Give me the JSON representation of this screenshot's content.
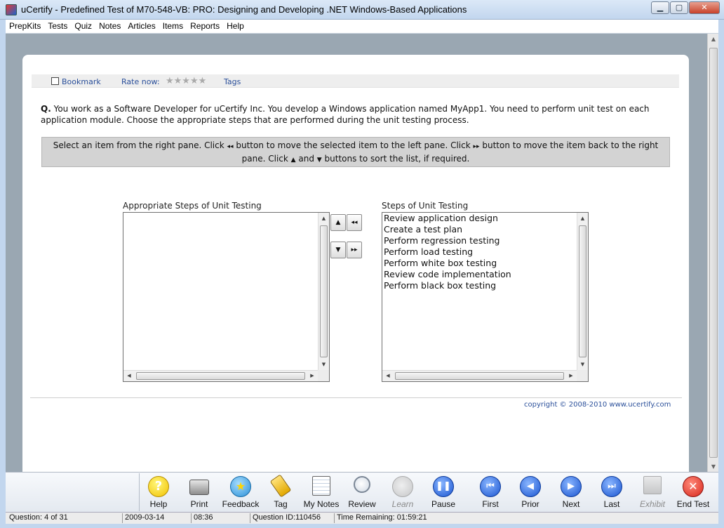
{
  "window": {
    "title": "uCertify - Predefined Test of  M70-548-VB: PRO: Designing and Developing .NET Windows-Based Applications",
    "minimize": "▁",
    "maximize": "▢",
    "close": "✕"
  },
  "menu": [
    "PrepKits",
    "Tests",
    "Quiz",
    "Notes",
    "Articles",
    "Items",
    "Reports",
    "Help"
  ],
  "toolbar": {
    "bookmark": "Bookmark",
    "rate_now": "Rate now:",
    "stars": "★★★★★",
    "rating": 0,
    "tags": "Tags"
  },
  "question": {
    "prefix": "Q.",
    "text": " You work as a Software Developer for uCertify Inc. You develop a Windows application named MyApp1. You need to perform unit test on each application module. Choose the appropriate steps that are performed during the unit testing process."
  },
  "instruction": {
    "part1": "Select an item from the right pane. Click ",
    "glyph_left": "◂◂",
    "part2": " button to move the selected item to the left pane. Click ",
    "glyph_right": "▸▸",
    "part3": " button to move the item back to the right pane. Click ",
    "glyph_up": "▲",
    "part4": " and ",
    "glyph_down": "▼",
    "part5": " buttons to sort the list, if required."
  },
  "left_list": {
    "label": "Appropriate Steps of Unit Testing",
    "items": []
  },
  "right_list": {
    "label": "Steps of Unit Testing",
    "items": [
      "Review application design",
      "Create a test plan",
      "Perform regression testing",
      "Perform load testing",
      "Perform white box testing",
      "Review code implementation",
      "Perform black box testing"
    ]
  },
  "buttons": {
    "move_up": "▲",
    "move_left": "◂◂",
    "move_down": "▼",
    "move_right": "▸▸"
  },
  "copyright": "copyright © 2008-2010 www.ucertify.com",
  "bottom_toolbar": [
    {
      "label": "Help",
      "glyph": "?"
    },
    {
      "label": "Print",
      "glyph": ""
    },
    {
      "label": "Feedback",
      "glyph": "★"
    },
    {
      "label": "Tag",
      "glyph": ""
    },
    {
      "label": "My Notes",
      "glyph": ""
    },
    {
      "label": "Review",
      "glyph": ""
    },
    {
      "label": "Learn",
      "glyph": ""
    },
    {
      "label": "Pause",
      "glyph": "❚❚"
    },
    {
      "label": "First",
      "glyph": "⏮"
    },
    {
      "label": "Prior",
      "glyph": "◀"
    },
    {
      "label": "Next",
      "glyph": "▶"
    },
    {
      "label": "Last",
      "glyph": "⏭"
    },
    {
      "label": "Exhibit",
      "glyph": ""
    },
    {
      "label": "End Test",
      "glyph": "✕"
    }
  ],
  "status": {
    "question": "Question: 4 of 31",
    "date": "2009-03-14",
    "time": "08:36",
    "question_id": "Question ID:110456",
    "time_remaining": "Time Remaining: 01:59:21"
  },
  "scroll_glyphs": {
    "up": "▲",
    "down": "▼",
    "left": "◀",
    "right": "▶"
  }
}
